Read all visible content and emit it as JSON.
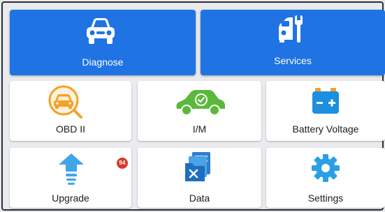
{
  "tiles": {
    "diagnose": {
      "label": "Diagnose",
      "icon": "car-front-icon"
    },
    "services": {
      "label": "Services",
      "icon": "car-service-wrench-icon"
    },
    "obd2": {
      "label": "OBD II",
      "icon": "car-magnifier-icon"
    },
    "im": {
      "label": "I/M",
      "icon": "car-check-icon"
    },
    "battery": {
      "label": "Battery Voltage",
      "icon": "battery-icon"
    },
    "upgrade": {
      "label": "Upgrade",
      "icon": "upgrade-arrow-icon",
      "badge": "94"
    },
    "data": {
      "label": "Data",
      "icon": "data-folder-icon"
    },
    "settings": {
      "label": "Settings",
      "icon": "gear-icon"
    }
  },
  "colors": {
    "accent_blue": "#1f73e3",
    "obd_orange": "#f3a226",
    "im_green": "#5cb83a",
    "battery_blue": "#1d8fe0",
    "upgrade_blue": "#3fa6e8",
    "settings_blue": "#2a9fe6",
    "badge_red": "#d63b2f"
  }
}
